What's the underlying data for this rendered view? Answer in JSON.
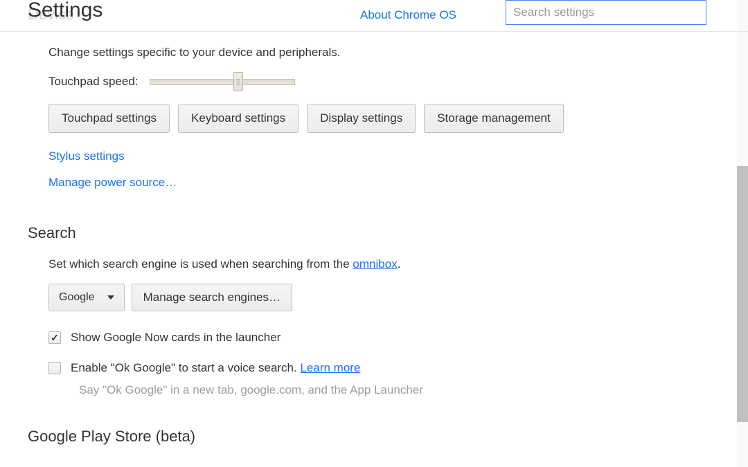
{
  "header": {
    "title": "Settings",
    "ghost": "Device",
    "about_link": "About Chrome OS",
    "search_placeholder": "Search settings"
  },
  "device": {
    "description": "Change settings specific to your device and peripherals.",
    "touchpad_label": "Touchpad speed:",
    "buttons": {
      "touchpad": "Touchpad settings",
      "keyboard": "Keyboard settings",
      "display": "Display settings",
      "storage": "Storage management"
    },
    "links": {
      "stylus": "Stylus settings",
      "power": "Manage power source…"
    }
  },
  "search": {
    "title": "Search",
    "desc_prefix": "Set which search engine is used when searching from the ",
    "desc_link": "omnibox",
    "desc_suffix": ".",
    "engine_selected": "Google",
    "manage_button": "Manage search engines…",
    "now_label": "Show Google Now cards in the launcher",
    "ok_google_label": "Enable \"Ok Google\" to start a voice search. ",
    "learn_more": "Learn more",
    "ok_google_sub": "Say \"Ok Google\" in a new tab, google.com, and the App Launcher"
  },
  "play": {
    "title": "Google Play Store (beta)"
  }
}
